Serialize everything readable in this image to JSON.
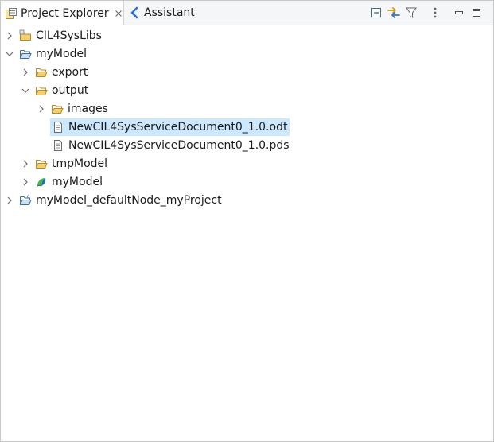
{
  "tabs": {
    "project_explorer": "Project Explorer",
    "assistant": "Assistant"
  },
  "toolbar": {
    "collapse_all": "collapse-all-icon",
    "link_with_editor": "link-with-editor-icon",
    "filter": "filter-icon",
    "view_menu": "view-menu-icon",
    "minimize": "minimize-icon",
    "maximize": "maximize-icon"
  },
  "tree": {
    "cil4syslibs": "CIL4SysLibs",
    "mymodel_project": "myModel",
    "export": "export",
    "output": "output",
    "images": "images",
    "odt_file": "NewCIL4SysServiceDocument0_1.0.odt",
    "pds_file": "NewCIL4SysServiceDocument0_1.0.pds",
    "tmpmodel": "tmpModel",
    "mymodel_model": "myModel",
    "default_node_project": "myModel_defaultNode_myProject"
  },
  "colors": {
    "selection": "#cce8ff",
    "folder": "#e8b74a",
    "assistant_accent": "#2f6fd6"
  }
}
